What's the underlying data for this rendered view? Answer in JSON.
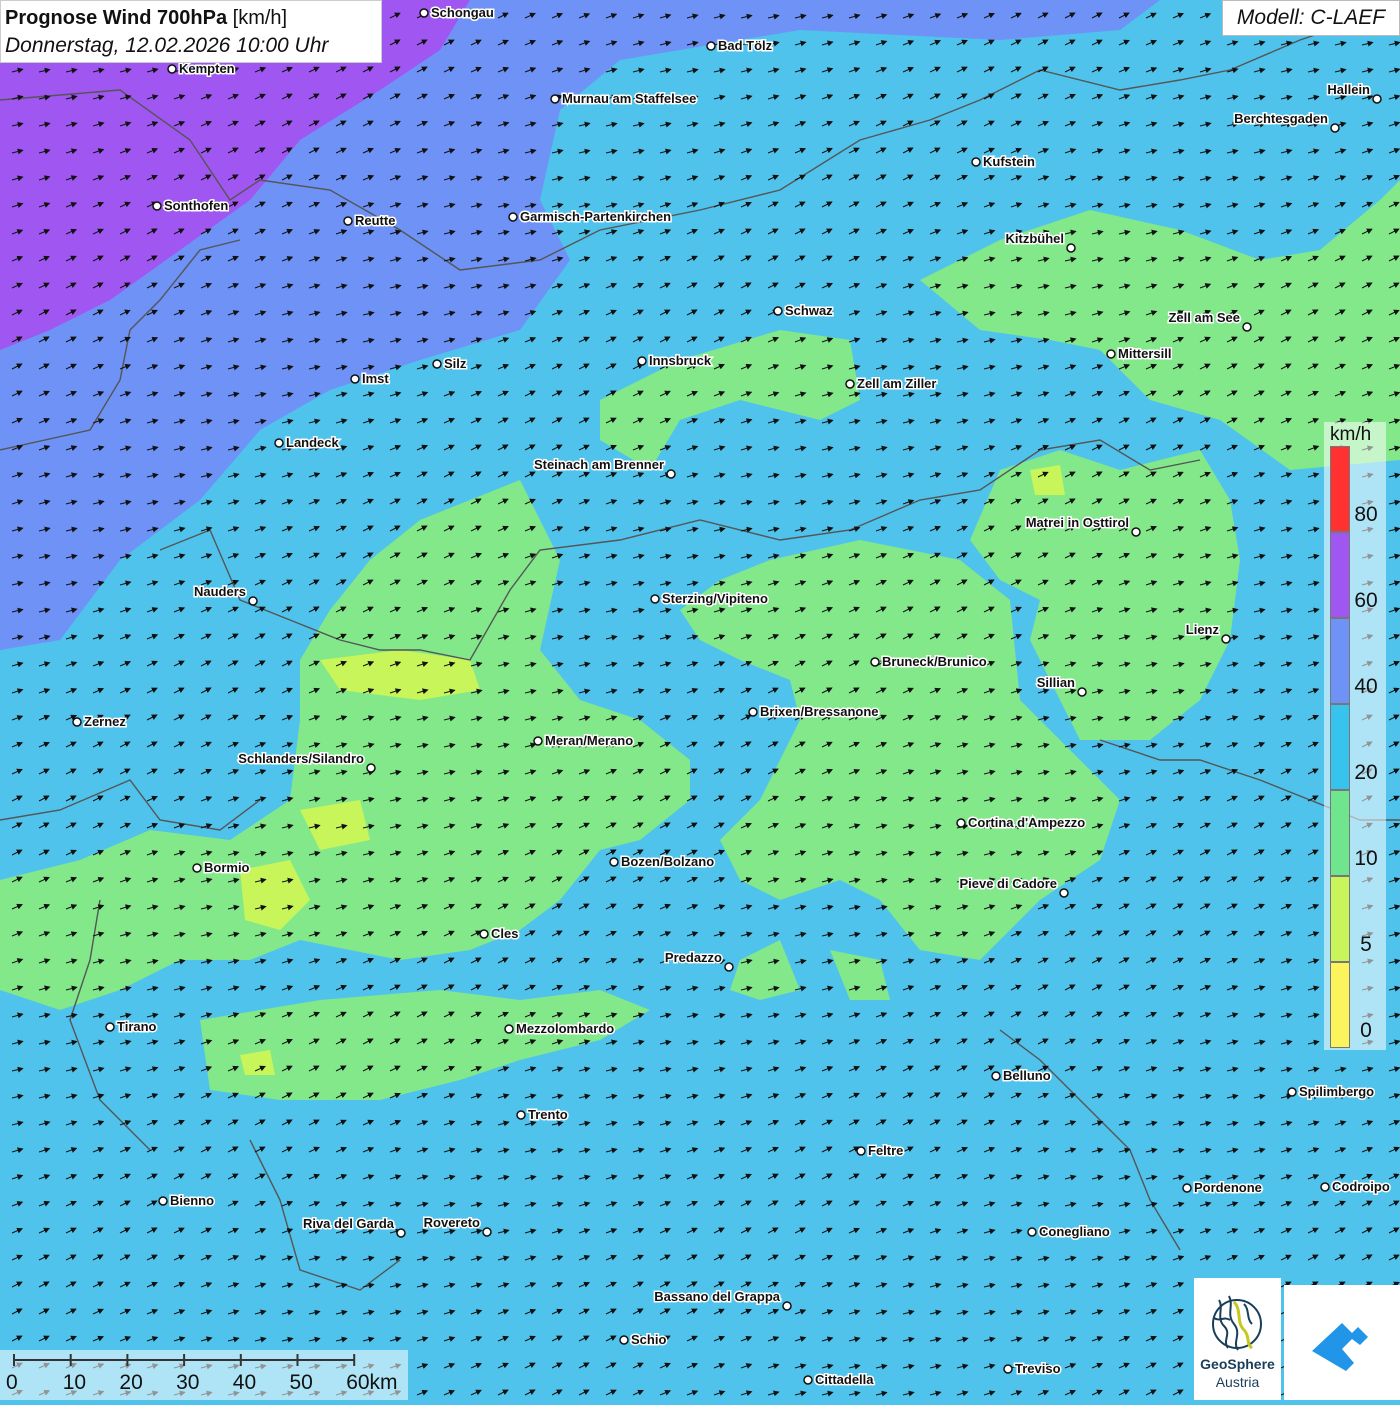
{
  "title": {
    "main": "Prognose Wind 700hPa",
    "unit": "[km/h]",
    "datetime": "Donnerstag, 12.02.2026 10:00 Uhr"
  },
  "model": "Modell: C-LAEF",
  "legend": {
    "unit": "km/h",
    "levels": [
      {
        "label": "80",
        "color": "#ff3131"
      },
      {
        "label": "60",
        "color": "#a056f0"
      },
      {
        "label": "40",
        "color": "#6e92f5"
      },
      {
        "label": "20",
        "color": "#36c4ef"
      },
      {
        "label": "10",
        "color": "#6fe68e"
      },
      {
        "label": "5",
        "color": "#c8f55a"
      },
      {
        "label": "0",
        "color": "#fbf45c"
      }
    ],
    "top_color": "#ff3131"
  },
  "scale": {
    "ticks": [
      "0",
      "10",
      "20",
      "30",
      "40",
      "50",
      "60km"
    ]
  },
  "logo": {
    "name": "GeoSphere",
    "country": "Austria"
  },
  "colors": {
    "calm": "#fbf45c",
    "light": "#c8f55a",
    "moderate": "#82e88a",
    "fresh": "#4fc3ec",
    "strong": "#6e92f5",
    "stormy": "#a056f0"
  },
  "cities": [
    {
      "name": "Schongau"
    },
    {
      "name": "Bad Tölz"
    },
    {
      "name": "Kempten"
    },
    {
      "name": "Murnau am Staffelsee"
    },
    {
      "name": "Hallein"
    },
    {
      "name": "Berchtesgaden"
    },
    {
      "name": "Kufstein"
    },
    {
      "name": "Sonthofen"
    },
    {
      "name": "Reutte"
    },
    {
      "name": "Garmisch-Partenkirchen"
    },
    {
      "name": "Kitzbühel"
    },
    {
      "name": "Schwaz"
    },
    {
      "name": "Zell am See"
    },
    {
      "name": "Innsbruck"
    },
    {
      "name": "Mittersill"
    },
    {
      "name": "Silz"
    },
    {
      "name": "Imst"
    },
    {
      "name": "Zell am Ziller"
    },
    {
      "name": "Landeck"
    },
    {
      "name": "Steinach am Brenner"
    },
    {
      "name": "Matrei in Osttirol"
    },
    {
      "name": "Nauders"
    },
    {
      "name": "Sterzing/Vipiteno"
    },
    {
      "name": "Lienz"
    },
    {
      "name": "Bruneck/Brunico"
    },
    {
      "name": "Sillian"
    },
    {
      "name": "Brixen/Bressanone"
    },
    {
      "name": "Zernez"
    },
    {
      "name": "Meran/Merano"
    },
    {
      "name": "Schlanders/Silandro"
    },
    {
      "name": "Cortina d'Ampezzo"
    },
    {
      "name": "Bozen/Bolzano"
    },
    {
      "name": "Bormio"
    },
    {
      "name": "Pieve di Cadore"
    },
    {
      "name": "Cles"
    },
    {
      "name": "Predazzo"
    },
    {
      "name": "Tirano"
    },
    {
      "name": "Mezzolombardo"
    },
    {
      "name": "Belluno"
    },
    {
      "name": "Spilimbergo"
    },
    {
      "name": "Trento"
    },
    {
      "name": "Feltre"
    },
    {
      "name": "Bienno"
    },
    {
      "name": "Pordenone"
    },
    {
      "name": "Codroipo"
    },
    {
      "name": "Riva del Garda"
    },
    {
      "name": "Rovereto"
    },
    {
      "name": "Conegliano"
    },
    {
      "name": "Bassano del Grappa"
    },
    {
      "name": "Schio"
    },
    {
      "name": "Treviso"
    },
    {
      "name": "Cittadella"
    }
  ]
}
